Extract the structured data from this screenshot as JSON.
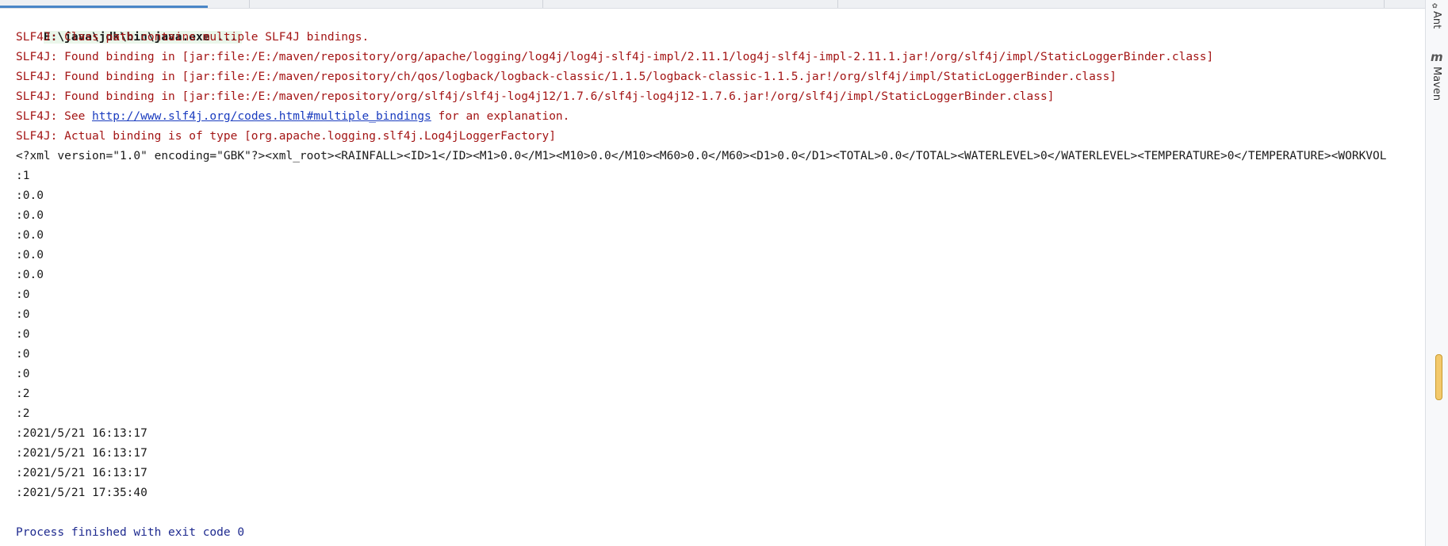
{
  "console": {
    "command": "E:\\java\\jdk\\bin\\java.exe ...",
    "slf4j_lines": [
      "SLF4J: Class path contains multiple SLF4J bindings.",
      "SLF4J: Found binding in [jar:file:/E:/maven/repository/org/apache/logging/log4j/log4j-slf4j-impl/2.11.1/log4j-slf4j-impl-2.11.1.jar!/org/slf4j/impl/StaticLoggerBinder.class]",
      "SLF4J: Found binding in [jar:file:/E:/maven/repository/ch/qos/logback/logback-classic/1.1.5/logback-classic-1.1.5.jar!/org/slf4j/impl/StaticLoggerBinder.class]",
      "SLF4J: Found binding in [jar:file:/E:/maven/repository/org/slf4j/slf4j-log4j12/1.7.6/slf4j-log4j12-1.7.6.jar!/org/slf4j/impl/StaticLoggerBinder.class]"
    ],
    "see_prefix": "SLF4J: See ",
    "see_link": "http://www.slf4j.org/codes.html#multiple_bindings",
    "see_suffix": " for an explanation.",
    "actual_binding": "SLF4J: Actual binding is of type [org.apache.logging.slf4j.Log4jLoggerFactory]",
    "xml_line": "<?xml version=\"1.0\" encoding=\"GBK\"?><xml_root><RAINFALL><ID>1</ID><M1>0.0</M1><M10>0.0</M10><M60>0.0</M60><D1>0.0</D1><TOTAL>0.0</TOTAL><WATERLEVEL>0</WATERLEVEL><TEMPERATURE>0</TEMPERATURE><WORKVOL",
    "values": [
      ":1",
      ":0.0",
      ":0.0",
      ":0.0",
      ":0.0",
      ":0.0",
      ":0",
      ":0",
      ":0",
      ":0",
      ":0",
      ":2",
      ":2",
      ":2021/5/21 16:13:17",
      ":2021/5/21 16:13:17",
      ":2021/5/21 16:13:17",
      ":2021/5/21 17:35:40"
    ],
    "exit_message": "Process finished with exit code 0"
  },
  "side_panel": {
    "ant_label": "Ant",
    "maven_icon": "m",
    "maven_label": "Maven"
  },
  "colors": {
    "error_text": "#a31515",
    "link_text": "#1a3cbf",
    "exit_text": "#1e2a8f",
    "command_bg": "#eaf6ea",
    "scroll_thumb": "#f3c96b"
  }
}
